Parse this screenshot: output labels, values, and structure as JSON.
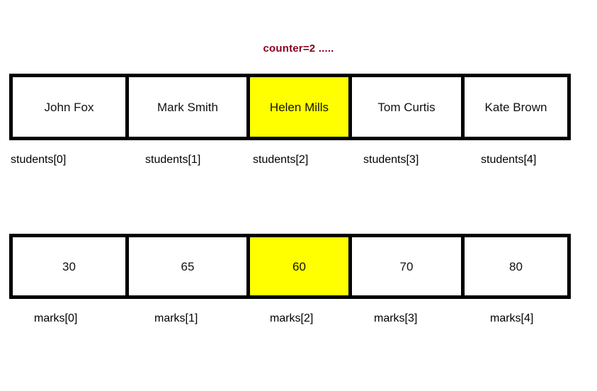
{
  "title": "counter=2 .....",
  "colors": {
    "highlight": "#ffff00",
    "title_text": "#8c0020",
    "border": "#000000",
    "cell_background": "#ffffff",
    "page_background": "#ffffff"
  },
  "students_array": {
    "name": "students",
    "cells": [
      {
        "value": "John Fox",
        "label": "students[0]",
        "highlighted": false
      },
      {
        "value": "Mark Smith",
        "label": "students[1]",
        "highlighted": false
      },
      {
        "value": "Helen Mills",
        "label": "students[2]",
        "highlighted": true
      },
      {
        "value": "Tom Curtis",
        "label": "students[3]",
        "highlighted": false
      },
      {
        "value": "Kate Brown",
        "label": "students[4]",
        "highlighted": false
      }
    ]
  },
  "marks_array": {
    "name": "marks",
    "cells": [
      {
        "value": "30",
        "label": "marks[0]",
        "highlighted": false
      },
      {
        "value": "65",
        "label": "marks[1]",
        "highlighted": false
      },
      {
        "value": "60",
        "label": "marks[2]",
        "highlighted": true
      },
      {
        "value": "70",
        "label": "marks[3]",
        "highlighted": false
      },
      {
        "value": "80",
        "label": "marks[4]",
        "highlighted": false
      }
    ]
  }
}
